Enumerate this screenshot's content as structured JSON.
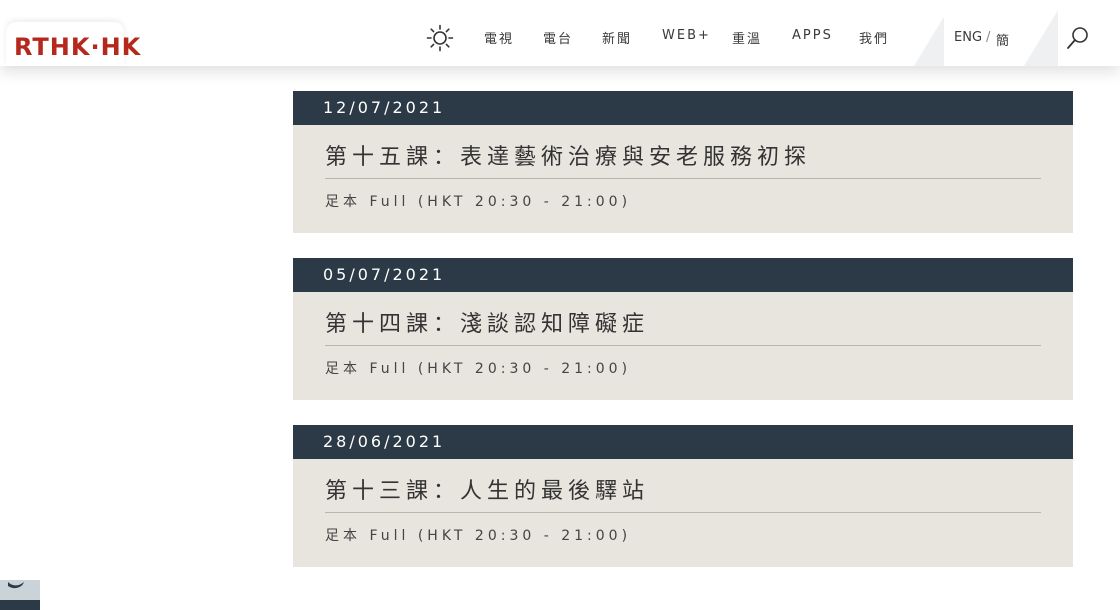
{
  "header": {
    "logo_text": "RTHK·HK",
    "nav": [
      {
        "label": "電視"
      },
      {
        "label": "電台"
      },
      {
        "label": "新聞"
      },
      {
        "label": "WEB+"
      },
      {
        "label": "重溫"
      },
      {
        "label": "APPS"
      },
      {
        "label": "我們"
      }
    ],
    "lang_eng": "ENG",
    "lang_sep": "/",
    "lang_simp": "簡",
    "icons": {
      "theme": "sun-icon",
      "search": "search-icon"
    }
  },
  "episodes": [
    {
      "date": "12/07/2021",
      "title": "第十五課：表達藝術治療與安老服務初探",
      "full": "足本 Full (HKT 20:30 - 21:00)"
    },
    {
      "date": "05/07/2021",
      "title": "第十四課：淺談認知障礙症",
      "full": "足本 Full (HKT 20:30 - 21:00)"
    },
    {
      "date": "28/06/2021",
      "title": "第十三課：人生的最後驛站",
      "full": "足本 Full (HKT 20:30 - 21:00)"
    }
  ],
  "colors": {
    "brand": "#b5291c",
    "date_bar": "#2b3a46",
    "card_bg": "#e8e4de"
  }
}
